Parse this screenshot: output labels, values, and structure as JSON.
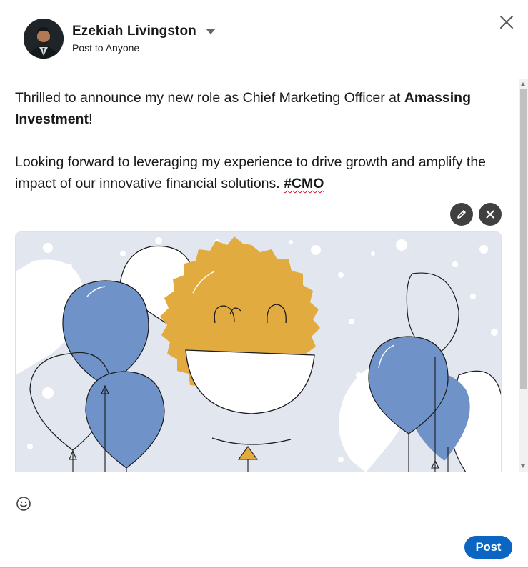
{
  "composer": {
    "author_name": "Ezekiah Livingston",
    "audience": "Post to Anyone",
    "icons": {
      "avatar": "profile-photo",
      "caret": "caret-down-icon",
      "close": "close-icon",
      "edit": "pencil-icon",
      "remove": "remove-icon",
      "emoji": "smiley-icon"
    }
  },
  "post": {
    "line1_text": "Thrilled to announce my new role as Chief Marketing Officer at ",
    "company": "Amassing Investment",
    "line1_end": "!",
    "line2_text": "Looking forward to leveraging my experience to drive growth and amplify the impact of our innovative financial solutions. ",
    "hashtag": "#CMO"
  },
  "footer": {
    "post_label": "Post"
  },
  "colors": {
    "primary": "#0a66c2",
    "image_bg": "#e2e7ef",
    "sun": "#e2ab40",
    "balloon_blue": "#6f93c9"
  }
}
